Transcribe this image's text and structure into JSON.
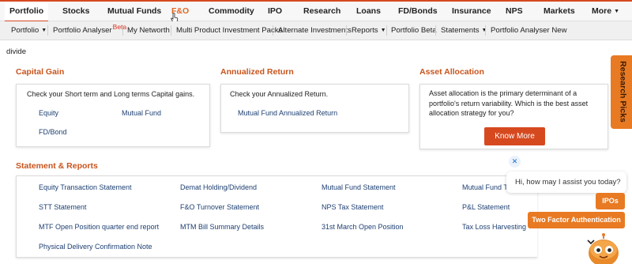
{
  "top_nav": {
    "items": [
      "Portfolio",
      "Stocks",
      "Mutual Funds",
      "F&O",
      "Commodity",
      "IPO",
      "Research",
      "Loans",
      "FD/Bonds",
      "Insurance",
      "NPS",
      "Markets",
      "More"
    ],
    "active": "Portfolio",
    "hovered": "F&O"
  },
  "sub_nav": {
    "items": [
      {
        "label": "Portfolio",
        "dropdown": true
      },
      {
        "label": "Portfolio Analyser",
        "badge": "Beta"
      },
      {
        "label": "My Networth"
      },
      {
        "label": "Multi Product Investment Packs"
      },
      {
        "label": "Alternate Investments"
      },
      {
        "label": "Reports",
        "dropdown": true
      },
      {
        "label": "Portfolio Beta"
      },
      {
        "label": "Statements",
        "dropdown": true
      },
      {
        "label": "Portfolio Analyser New"
      }
    ]
  },
  "stray_text": "divide",
  "capital_gain": {
    "title": "Capital Gain",
    "description": "Check your Short term and Long terms Capital gains.",
    "links": [
      "Equity",
      "Mutual Fund",
      "FD/Bond"
    ]
  },
  "annualized_return": {
    "title": "Annualized Return",
    "description": "Check your Annualized Return.",
    "links": [
      "Mutual Fund Annualized Return"
    ]
  },
  "asset_allocation": {
    "title": "Asset Allocation",
    "description": "Asset allocation is the primary determinant of a portfolio's return variability. Which is the best asset allocation strategy for you?",
    "button": "Know More"
  },
  "statements": {
    "title": "Statement & Reports",
    "links": [
      [
        "Equity Transaction Statement",
        "Demat Holding/Dividend",
        "Mutual Fund Statement",
        "Mutual Fund Tax"
      ],
      [
        "STT Statement",
        "F&O Turnover Statement",
        "NPS Tax Statement",
        "P&L Statement"
      ],
      [
        "MTF Open Position quarter end report",
        "MTM Bill Summary Details",
        "31st March Open Position",
        "Tax Loss Harvesting"
      ],
      [
        "Physical Delivery Confirmation Note"
      ]
    ]
  },
  "research_tab": "Research Picks",
  "chat": {
    "greeting": "Hi, how may I assist you today?",
    "close_glyph": "✕",
    "chips": [
      "IPOs",
      "Two Factor Authentication"
    ]
  },
  "colors": {
    "accent": "#d6491f",
    "link": "#1d3f72",
    "chip": "#e87a23",
    "title": "#c8541c"
  },
  "icons": {
    "cursor": "hand-pointer-icon",
    "chat_close": "close-icon",
    "bot": "robot-avatar-icon"
  }
}
